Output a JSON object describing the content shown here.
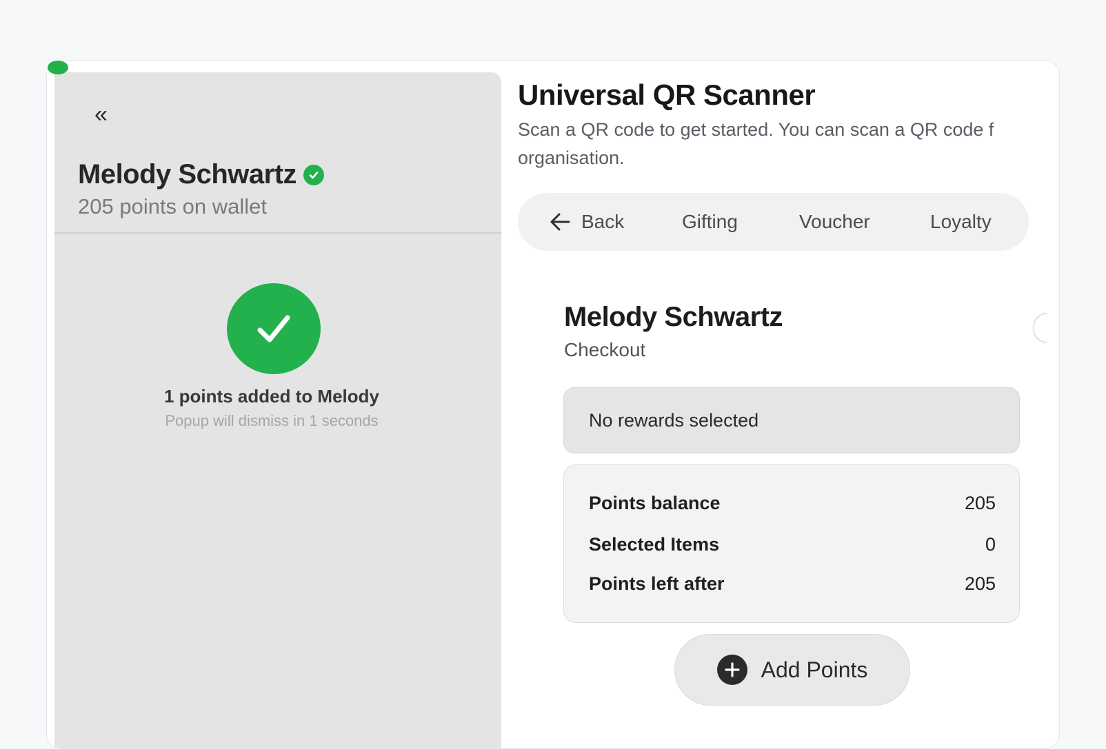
{
  "left_panel": {
    "collapse_icon": "double-chevron-left-icon",
    "collapse_glyph": "«",
    "user_name": "Melody Schwartz",
    "verified_icon": "verified-check-icon",
    "points_text": "205 points on wallet",
    "success_icon": "checkmark-icon",
    "success_message": "1 points added to Melody",
    "dismiss_message": "Popup will dismiss in 1 seconds"
  },
  "header": {
    "title": "Universal QR Scanner",
    "description": "Scan a QR code to get started. You can scan a QR code f",
    "description_line2": "organisation."
  },
  "tabs": {
    "back_label": "Back",
    "back_icon": "arrow-left-icon",
    "items": [
      "Gifting",
      "Voucher",
      "Loyalty"
    ]
  },
  "checkout": {
    "customer_name": "Melody Schwartz",
    "subtitle": "Checkout",
    "rewards_text": "No rewards selected",
    "summary": [
      {
        "label": "Points balance",
        "value": "205"
      },
      {
        "label": "Selected Items",
        "value": "0"
      },
      {
        "label": "Points left after",
        "value": "205"
      }
    ],
    "add_points_label": "Add Points",
    "add_points_icon": "plus-circle-icon"
  },
  "colors": {
    "success_green": "#22b14c",
    "panel_gray": "#e4e4e4"
  }
}
